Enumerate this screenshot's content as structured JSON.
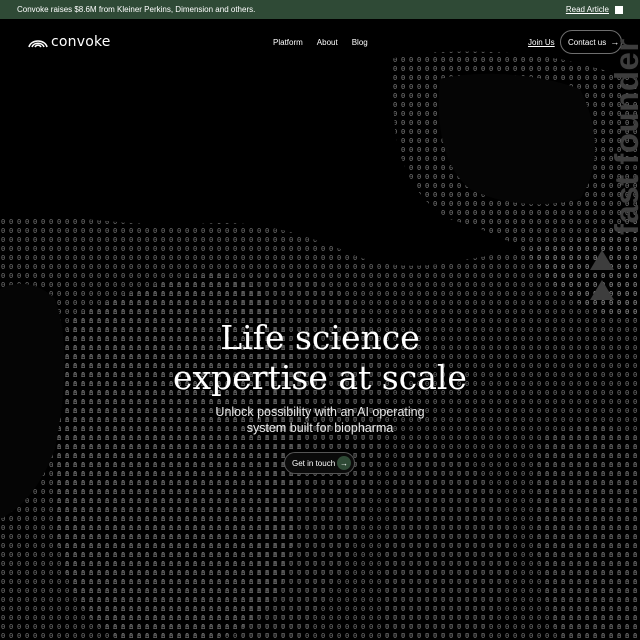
{
  "banner": {
    "message": "Convoke raises $8.6M from Kleiner Perkins, Dimension and others.",
    "read_label": "Read Article"
  },
  "nav": {
    "logo": "convoke",
    "links": [
      "Platform",
      "About",
      "Blog"
    ],
    "join_label": "Join Us",
    "contact_label": "Contact us"
  },
  "hero": {
    "title_line1": "Life science",
    "title_line2": "expertise at scale",
    "subtitle_line1": "Unlock possibility with an AI operating",
    "subtitle_line2": "system built for biopharma",
    "cta_label": "Get in touch"
  },
  "badge": {
    "text": "fast founder"
  },
  "colors": {
    "banner_bg": "#2f4a36",
    "page_bg": "#000000",
    "accent": "#2f4a36"
  },
  "icons": {
    "logo": "arc-logo-icon",
    "contact_arrow": "arrow-right-icon",
    "cta_arrow": "arrow-right-icon",
    "banner_close": "square-icon"
  }
}
